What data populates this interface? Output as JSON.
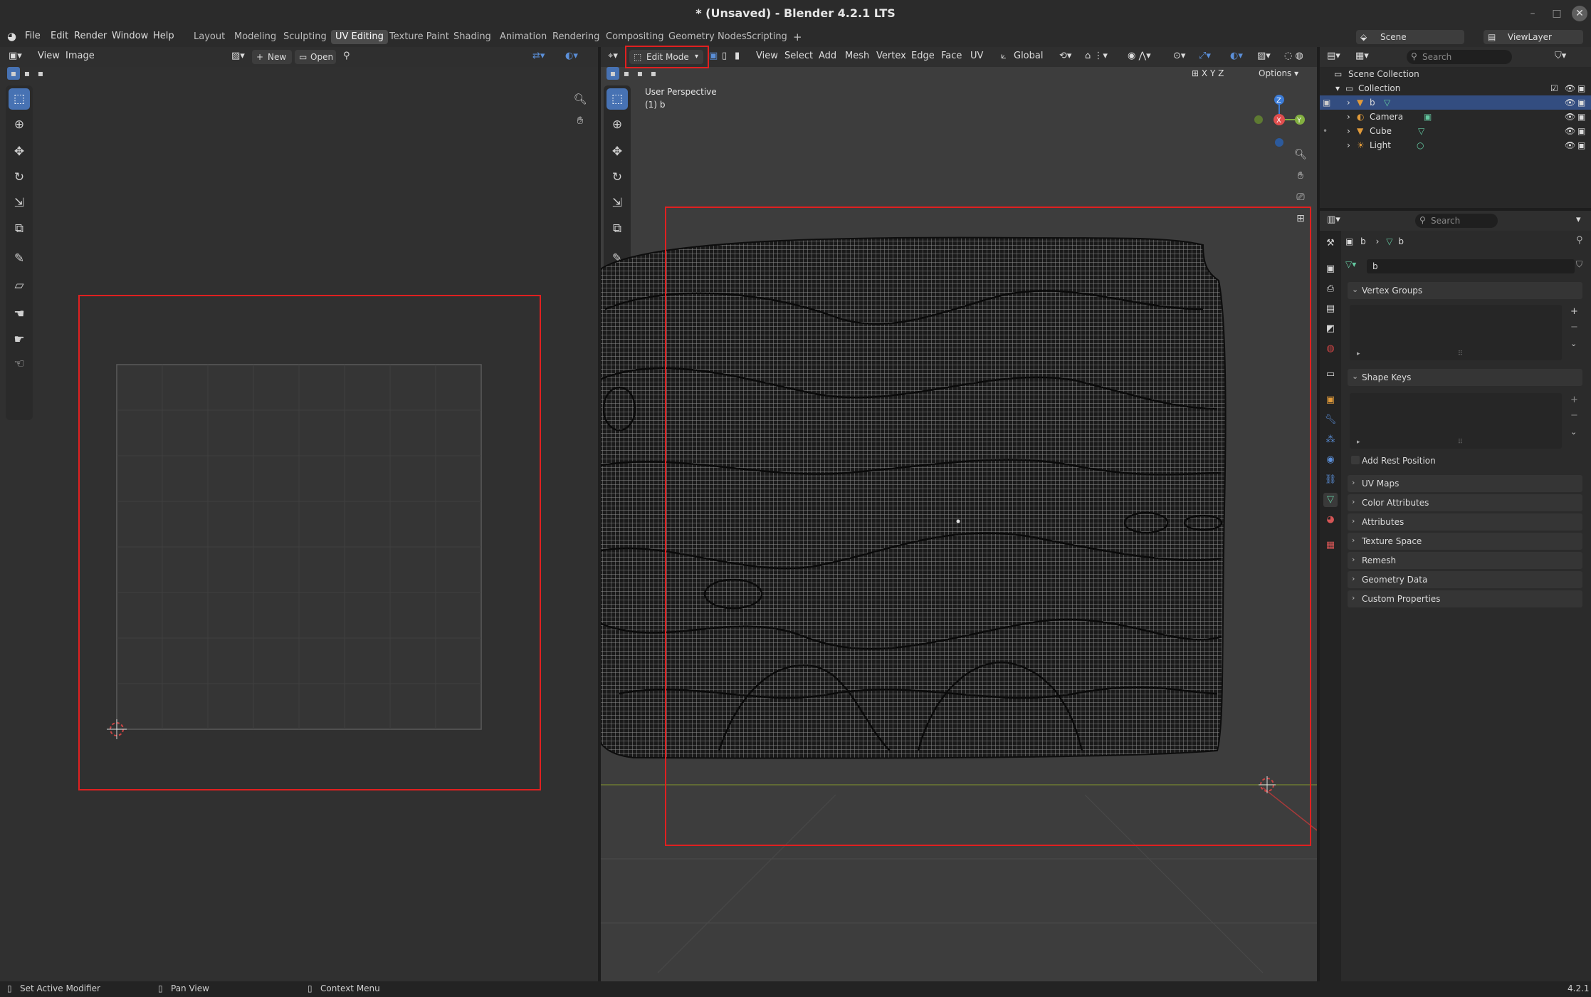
{
  "window": {
    "title": "* (Unsaved) - Blender 4.2.1 LTS"
  },
  "menu": [
    "File",
    "Edit",
    "Render",
    "Window",
    "Help"
  ],
  "workspaces": [
    "Layout",
    "Modeling",
    "Sculpting",
    "UV Editing",
    "Texture Paint",
    "Shading",
    "Animation",
    "Rendering",
    "Compositing",
    "Geometry Nodes",
    "Scripting"
  ],
  "active_workspace": "UV Editing",
  "scene": {
    "name": "Scene",
    "viewlayer": "ViewLayer"
  },
  "uv_editor": {
    "menus": [
      "View",
      "Image"
    ],
    "new_label": "New",
    "open_label": "Open"
  },
  "viewport": {
    "mode": "Edit Mode",
    "menus": [
      "View",
      "Select",
      "Add",
      "Mesh",
      "Vertex",
      "Edge",
      "Face",
      "UV"
    ],
    "orientation": "Global",
    "options_label": "Options",
    "perspective": "User Perspective",
    "object_line": "(1) b",
    "axes": [
      "X",
      "Y",
      "Z"
    ]
  },
  "outliner": {
    "search_placeholder": "Search",
    "root": "Scene Collection",
    "collection": "Collection",
    "items": [
      "b",
      "Camera",
      "Cube",
      "Light"
    ]
  },
  "properties": {
    "search_placeholder": "Search",
    "breadcrumb": [
      "b",
      "b"
    ],
    "data_name": "b",
    "panels": {
      "vertex_groups": "Vertex Groups",
      "shape_keys": "Shape Keys",
      "add_rest_position": "Add Rest Position",
      "uv_maps": "UV Maps",
      "color_attributes": "Color Attributes",
      "attributes": "Attributes",
      "texture_space": "Texture Space",
      "remesh": "Remesh",
      "geometry_data": "Geometry Data",
      "custom_properties": "Custom Properties"
    }
  },
  "status": {
    "left": "Set Active Modifier",
    "middle": "Pan View",
    "right": "Context Menu",
    "version": "4.2.1"
  },
  "colors": {
    "accent": "#4772b3",
    "highlight_box": "#e02020",
    "background": "#303030"
  }
}
